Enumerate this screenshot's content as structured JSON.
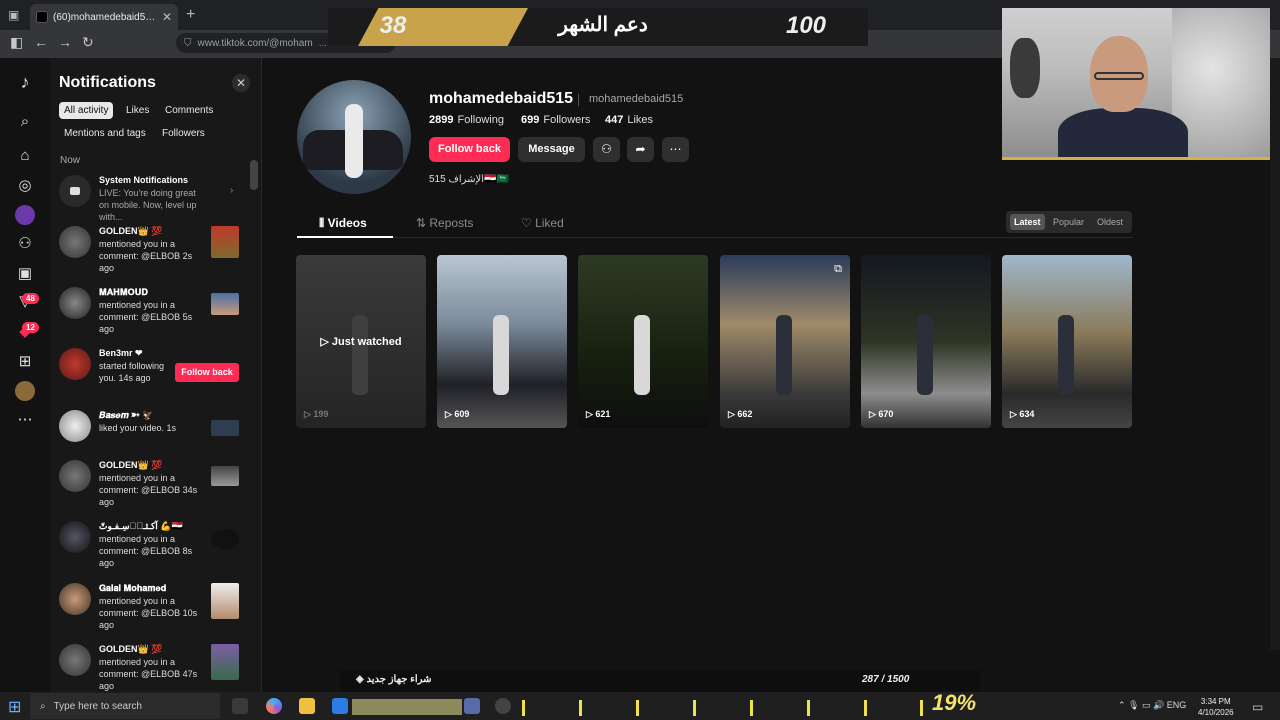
{
  "browser": {
    "tab_title": "(60)mohamedebaid515 (@moh",
    "url_visible": "www.tiktok.com/@moham",
    "url_dim": "..."
  },
  "overlay": {
    "left_number": "38",
    "center_text": "دعم الشهر",
    "right_number": "100",
    "bottom_left": "شراء جهاز جديد",
    "bottom_right": "287 / 1500",
    "progress_text": "19%",
    "progress_fraction": 0.19
  },
  "rail": {
    "badge_inbox": "48",
    "badge_messages": "12"
  },
  "notifications": {
    "title": "Notifications",
    "filters": [
      "All activity",
      "Likes",
      "Comments",
      "Mentions and tags",
      "Followers"
    ],
    "section_now": "Now",
    "items": [
      {
        "name": "System Notifications",
        "message": "LIVE: You're doing great on mobile. Now, level up with..."
      },
      {
        "name": "GOLDEN👑 💯",
        "message": "mentioned you in a comment: @ELBOB 2s ago"
      },
      {
        "name": "𝐌𝐀𝐇𝐌𝐎𝐔𝐃",
        "message": "mentioned you in a comment: @ELBOB 5s ago"
      },
      {
        "name": "Ben3mr ❤",
        "message": "started following you. 14s ago",
        "button": "Follow back"
      },
      {
        "name": "𝑩𝒂𝒔𝒆𝒎 ➳ 🦅",
        "message": "liked your video. 1s"
      },
      {
        "name": "GOLDEN👑 💯",
        "message": "mentioned you in a comment: @ELBOB 34s ago"
      },
      {
        "name": "آكـثـر٘سِـفـوتّ 💪🇪🇬",
        "message": "mentioned you in a comment: @ELBOB 8s ago"
      },
      {
        "name": "𝐆𝐚𝐥𝐚𝐥 𝐌𝐨𝐡𝐚𝐦𝐞𝐝",
        "message": "mentioned you in a comment: @ELBOB 10s ago"
      },
      {
        "name": "GOLDEN👑 💯",
        "message": "mentioned you in a comment: @ELBOB 47s ago"
      }
    ]
  },
  "profile": {
    "username": "mohamedebaid515",
    "handle": "mohamedebaid515",
    "following_count": "2899",
    "following_label": "Following",
    "followers_count": "699",
    "followers_label": "Followers",
    "likes_count": "447",
    "likes_label": "Likes",
    "follow_back": "Follow back",
    "message": "Message",
    "bio": "515 الإشراف🇪🇬🇸🇦",
    "tabs": [
      "Videos",
      "Reposts",
      "Liked"
    ],
    "sort": [
      "Latest",
      "Popular",
      "Oldest"
    ],
    "just_watched": "Just watched",
    "videos": [
      {
        "views": "199"
      },
      {
        "views": "609"
      },
      {
        "views": "621"
      },
      {
        "views": "662"
      },
      {
        "views": "670"
      },
      {
        "views": "634"
      }
    ]
  },
  "taskbar": {
    "search_placeholder": "Type here to search",
    "lang": "ENG",
    "time": "3:34 PM",
    "date": "4/10/2026"
  }
}
